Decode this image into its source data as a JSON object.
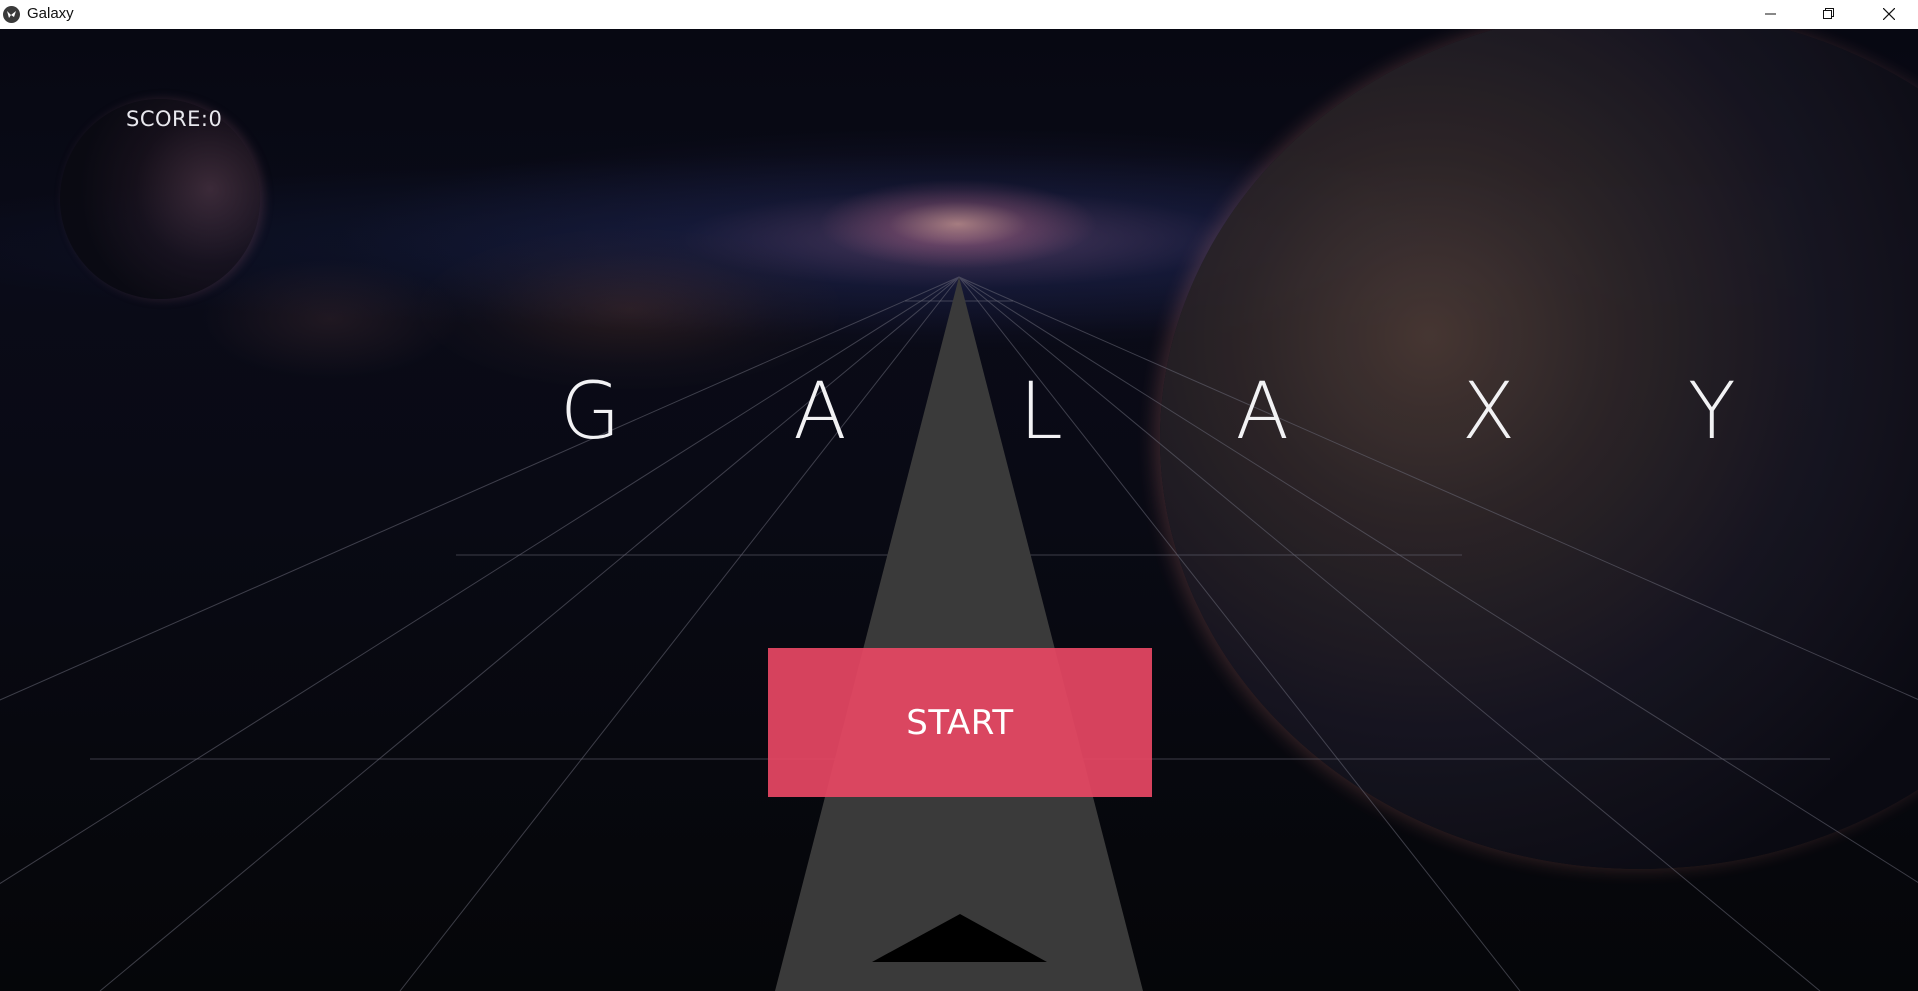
{
  "window": {
    "title": "Galaxy",
    "icon": "kivy-app-icon",
    "controls": {
      "minimize": "minimize-icon",
      "maximize": "restore-icon",
      "close": "close-icon"
    }
  },
  "game": {
    "score_label": "SCORE:0",
    "title": "G A L A X Y",
    "start_button_label": "START",
    "colors": {
      "start_button": "#e84864",
      "track": "#3a3a3a",
      "ship": "#000000",
      "grid_lines": "#5a5a66"
    }
  }
}
